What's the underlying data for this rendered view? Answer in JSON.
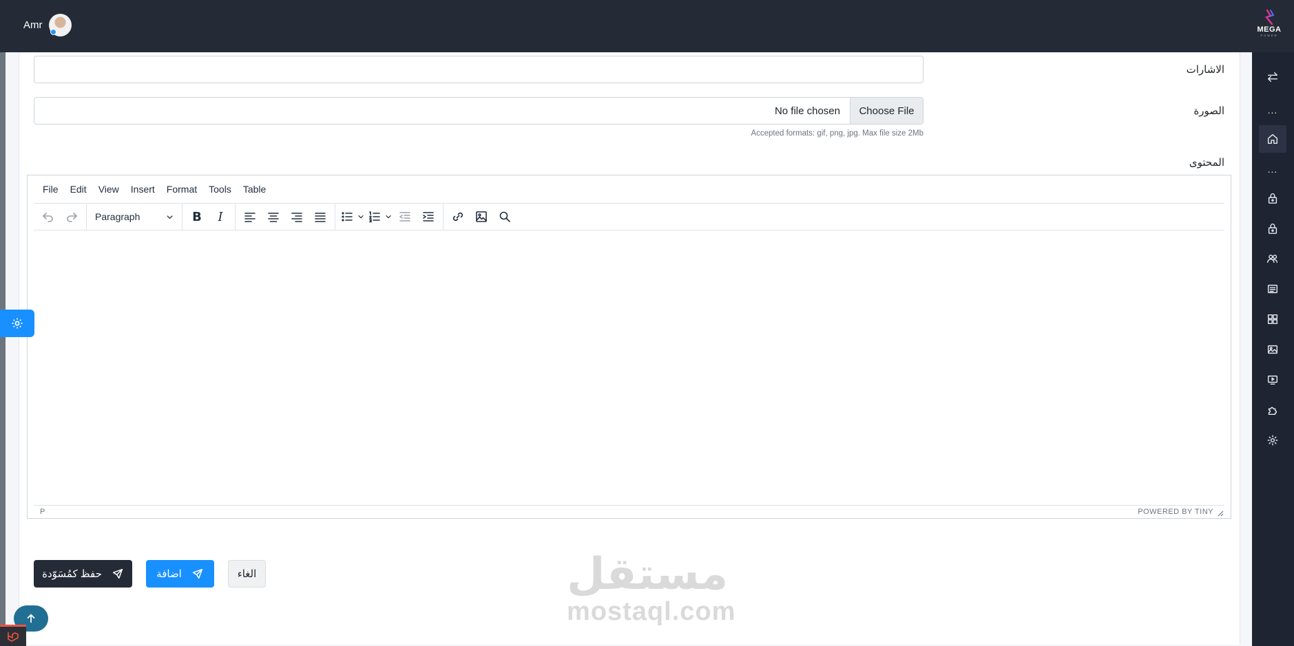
{
  "header": {
    "user_name": "Amr",
    "brand_name": "MEGA",
    "brand_sub": "POWER"
  },
  "sidebar": {
    "items": [
      {
        "icon": "swap-arrows-icon"
      },
      {
        "icon": "more-dots-icon",
        "label": "..."
      },
      {
        "icon": "home-icon",
        "active": true
      },
      {
        "icon": "more-dots-icon",
        "label": "..."
      },
      {
        "icon": "lock-icon"
      },
      {
        "icon": "lock-icon"
      },
      {
        "icon": "users-icon"
      },
      {
        "icon": "list-icon"
      },
      {
        "icon": "grid-icon"
      },
      {
        "icon": "image-icon"
      },
      {
        "icon": "video-icon"
      },
      {
        "icon": "puzzle-icon"
      },
      {
        "icon": "gear-icon"
      }
    ]
  },
  "form": {
    "tags_label": "الاشارات",
    "tags_value": "",
    "image_label": "الصورة",
    "file_button": "Choose File",
    "file_status": "No file chosen",
    "file_hint": "Accepted formats: gif, png, jpg. Max file size 2Mb",
    "content_label": "المحتوى"
  },
  "editor": {
    "menu": [
      "File",
      "Edit",
      "View",
      "Insert",
      "Format",
      "Tools",
      "Table"
    ],
    "block_format": "Paragraph",
    "status_path": "P",
    "powered_by": "POWERED BY TINY"
  },
  "actions": {
    "save_draft": "حفظ كمُسَوّدة",
    "add": "اضافة",
    "cancel": "الغاء"
  },
  "watermark": {
    "arabic": "مستقل",
    "latin": "mostaql.com"
  },
  "colors": {
    "topbar": "#252a37",
    "sidebar": "#1f2433",
    "primary": "#1890ff",
    "dark_button": "#252a37"
  }
}
